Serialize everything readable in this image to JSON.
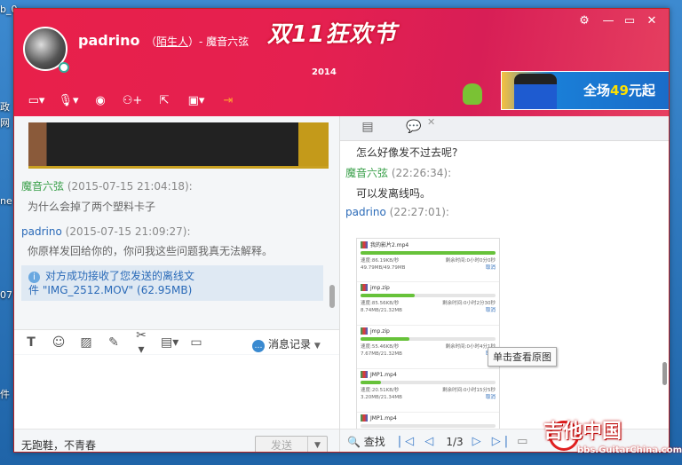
{
  "window": {
    "user_name": "padrino",
    "user_tag_open": "（",
    "user_tag_link": "陌生人",
    "user_tag_close": "）- 魔音六弦",
    "promo_title": "双11狂欢节",
    "promo_year": "2014",
    "controls": [
      "⚙",
      "—",
      "▭",
      "✕"
    ]
  },
  "toolbar": {
    "icons": [
      "folder-icon",
      "microphone-icon",
      "camera-icon",
      "add-user-icon",
      "share-screen-icon",
      "app-icon",
      "exit-icon"
    ]
  },
  "ad": {
    "text_prefix": "全场",
    "text_number": "49",
    "text_suffix": "元起"
  },
  "left": {
    "messages": [
      {
        "sender": "魔音六弦",
        "time": "(2015-07-15 21:04:18):",
        "body": "为什么会掉了两个塑料卡子"
      },
      {
        "sender": "padrino",
        "time": "(2015-07-15 21:09:27):",
        "body": "你原样发回给你的，你问我这些问题我真无法解释。"
      }
    ],
    "notice_line1": "对方成功接收了您发送的离线文",
    "notice_line2": "件 \"IMG_2512.MOV\" (62.95MB)",
    "history_label": "消息记录",
    "status_text": "无跑鞋，不青春",
    "send_label": "发送",
    "send_arrow": "▼"
  },
  "right": {
    "messages": [
      {
        "kind": "body",
        "text": "怎么好像发不过去呢?"
      },
      {
        "kind": "header",
        "sender": "魔音六弦",
        "time": "(22:26:34):"
      },
      {
        "kind": "body",
        "text": "可以发离线吗。"
      },
      {
        "kind": "header",
        "sender": "padrino",
        "time": "(22:27:01):"
      }
    ],
    "transfers": [
      {
        "name": "我的影片2.mp4",
        "progress": 1.0,
        "speed": "速度:86.19KB/秒",
        "remain": "剩余时间:0小时0分0秒",
        "size": "49.79MB/49.79MB",
        "cancel": "取消"
      },
      {
        "name": "jmp.zip",
        "progress": 0.4,
        "speed": "速度:85.56KB/秒",
        "remain": "剩余时间:0小时2分30秒",
        "size": "8.74MB/21.32MB",
        "cancel": "取消"
      },
      {
        "name": "jmp.zip",
        "progress": 0.36,
        "speed": "速度:55.46KB/秒",
        "remain": "剩余时间:0小时4分1秒",
        "size": "7.67MB/21.32MB",
        "cancel": "取消"
      },
      {
        "name": "JMP1.mp4",
        "progress": 0.15,
        "speed": "速度:20.51KB/秒",
        "remain": "剩余时间:0小时15分5秒",
        "size": "3.20MB/21.34MB",
        "cancel": "取消"
      },
      {
        "name": "JMP1.mp4",
        "progress": 0.0,
        "speed": "",
        "remain": "",
        "size": "",
        "cancel": ""
      }
    ],
    "tooltip": "单击查看原图",
    "find_label": "查找",
    "page": "1/3"
  },
  "watermark": {
    "title": "吉他中国",
    "url": "bbs.GuitarChina.com"
  }
}
